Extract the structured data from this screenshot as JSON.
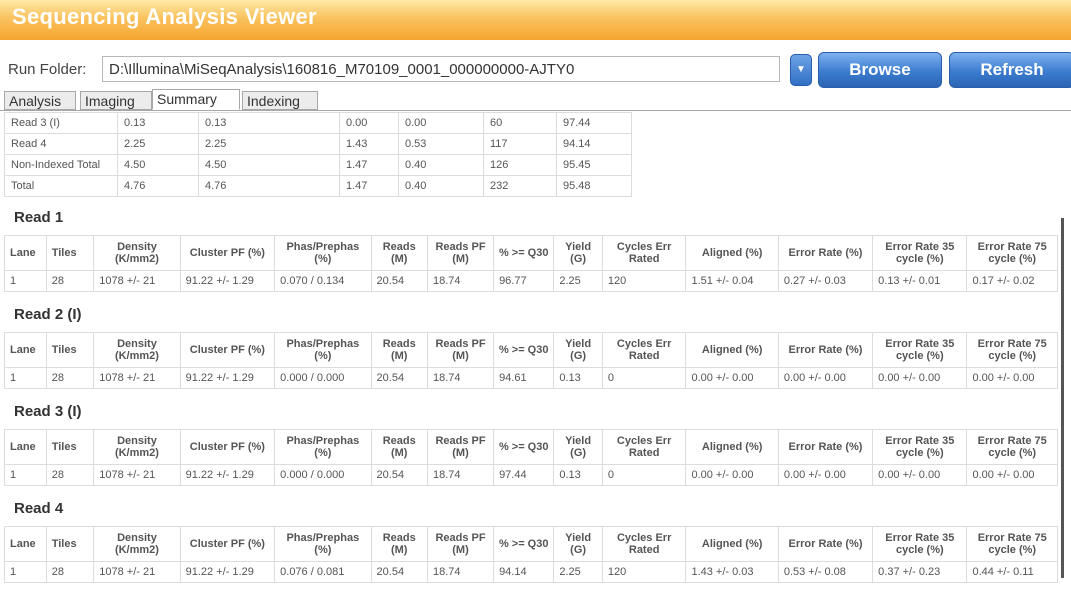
{
  "app": {
    "title": "Sequencing Analysis Viewer"
  },
  "run_folder": {
    "label": "Run Folder:",
    "value": "D:\\Illumina\\MiSeqAnalysis\\160816_M70109_0001_000000000-AJTY0",
    "browse_label": "Browse",
    "refresh_label": "Refresh"
  },
  "tabs": [
    {
      "label": "Analysis",
      "active": false
    },
    {
      "label": "Imaging",
      "active": false
    },
    {
      "label": "Summary",
      "active": true
    },
    {
      "label": "Indexing",
      "active": false
    }
  ],
  "summary_rows": [
    [
      "Read 3 (I)",
      "0.13",
      "0.13",
      "0.00",
      "0.00",
      "60",
      "97.44"
    ],
    [
      "Read 4",
      "2.25",
      "2.25",
      "1.43",
      "0.53",
      "117",
      "94.14"
    ],
    [
      "Non-Indexed Total",
      "4.50",
      "4.50",
      "1.47",
      "0.40",
      "126",
      "95.45"
    ],
    [
      "Total",
      "4.76",
      "4.76",
      "1.47",
      "0.40",
      "232",
      "95.48"
    ]
  ],
  "read_headers": [
    "Lane",
    "Tiles",
    "Density (K/mm2)",
    "Cluster PF (%)",
    "Phas/Prephas (%)",
    "Reads (M)",
    "Reads PF (M)",
    "% >= Q30",
    "Yield (G)",
    "Cycles Err Rated",
    "Aligned (%)",
    "Error Rate (%)",
    "Error Rate 35 cycle (%)",
    "Error Rate 75 cycle (%)"
  ],
  "reads": [
    {
      "title": "Read 1",
      "row": [
        "1",
        "28",
        "1078 +/- 21",
        "91.22 +/- 1.29",
        "0.070 / 0.134",
        "20.54",
        "18.74",
        "96.77",
        "2.25",
        "120",
        "1.51 +/- 0.04",
        "0.27 +/- 0.03",
        "0.13 +/- 0.01",
        "0.17 +/- 0.02"
      ]
    },
    {
      "title": "Read 2 (I)",
      "row": [
        "1",
        "28",
        "1078 +/- 21",
        "91.22 +/- 1.29",
        "0.000 / 0.000",
        "20.54",
        "18.74",
        "94.61",
        "0.13",
        "0",
        "0.00 +/- 0.00",
        "0.00 +/- 0.00",
        "0.00 +/- 0.00",
        "0.00 +/- 0.00"
      ]
    },
    {
      "title": "Read 3 (I)",
      "row": [
        "1",
        "28",
        "1078 +/- 21",
        "91.22 +/- 1.29",
        "0.000 / 0.000",
        "20.54",
        "18.74",
        "97.44",
        "0.13",
        "0",
        "0.00 +/- 0.00",
        "0.00 +/- 0.00",
        "0.00 +/- 0.00",
        "0.00 +/- 0.00"
      ]
    },
    {
      "title": "Read 4",
      "row": [
        "1",
        "28",
        "1078 +/- 21",
        "91.22 +/- 1.29",
        "0.076 / 0.081",
        "20.54",
        "18.74",
        "94.14",
        "2.25",
        "120",
        "1.43 +/- 0.03",
        "0.53 +/- 0.08",
        "0.37 +/- 0.23",
        "0.44 +/- 0.11"
      ]
    }
  ]
}
